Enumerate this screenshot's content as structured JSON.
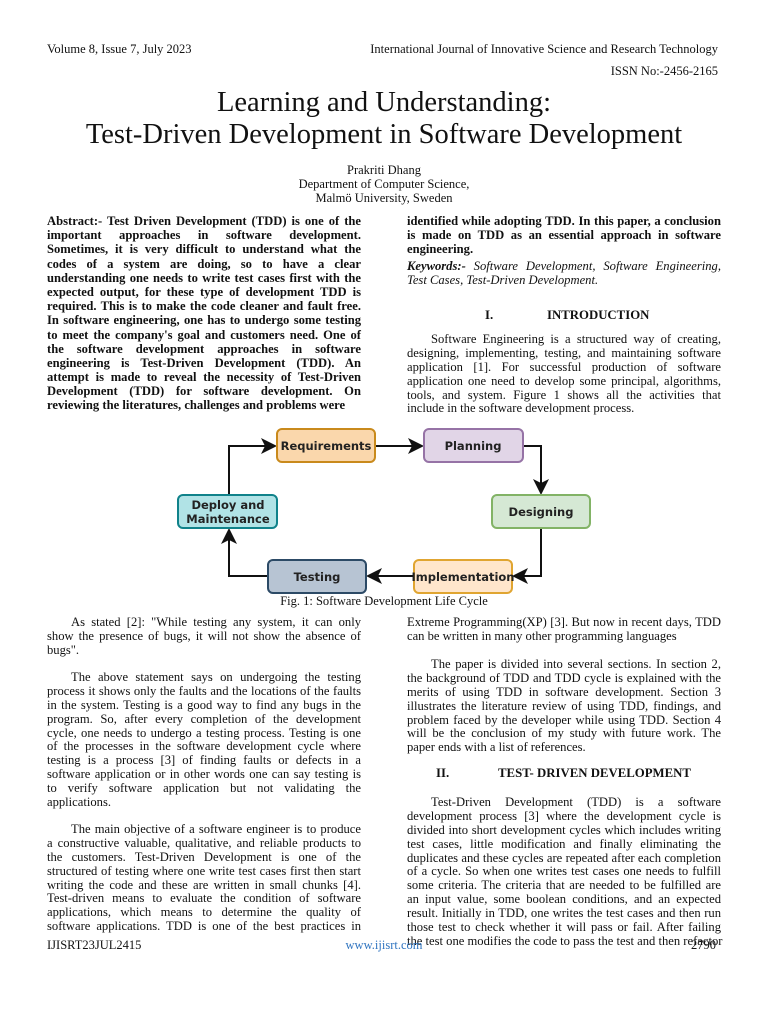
{
  "header": {
    "volume": "Volume 8, Issue 7, July 2023",
    "journal": "International Journal of Innovative Science and Research Technology",
    "issn": "ISSN No:-2456-2165"
  },
  "title": {
    "line1": "Learning and Understanding:",
    "line2": "Test-Driven Development in Software Development"
  },
  "author": {
    "name": "Prakriti Dhang",
    "dept": "Department of Computer Science,",
    "univ": "Malmö University, Sweden"
  },
  "abstract_left": [
    "Abstract:- Test Driven Development (TDD) is one of the",
    "important approaches in software development.",
    "Sometimes, it is very difficult to understand what the",
    "codes of a system are doing, so to have a clear",
    "understanding one needs to write test cases first with the",
    "expected output, for these type of development TDD is",
    "required. This is to make the code cleaner and fault free.",
    "In software engineering, one has to undergo some testing",
    "to meet the company's goal and customers need. One of",
    "the software development approaches in software",
    "engineering is Test-Driven Development (TDD). An",
    "attempt is made to reveal the necessity of Test-Driven",
    "Development (TDD) for software development. On",
    "reviewing the literatures, challenges and problems were"
  ],
  "abstract_right": [
    "identified while adopting TDD. In this paper, a conclusion",
    "is made on TDD as an essential approach in software",
    "engineering."
  ],
  "keywords": {
    "label": "Keywords:-",
    "line1": "Software Development, Software Engineering,",
    "line2": "Test Cases, Test-Driven Development."
  },
  "section1": {
    "num": "I.",
    "title": "INTRODUCTION"
  },
  "intro": [
    "Software Engineering is a structured way of creating,",
    "designing, implementing, testing, and maintaining software",
    "application [1]. For successful production of software",
    "application one need to develop some principal, algorithms,",
    "tools, and system. Figure 1 shows all the activities that",
    "include in the software development process."
  ],
  "figure": {
    "boxes": {
      "requirements": "Requirements",
      "planning": "Planning",
      "designing": "Designing",
      "implementation": "Implementation",
      "testing": "Testing",
      "deploy1": "Deploy and",
      "deploy2": "Maintenance"
    },
    "caption": "Fig. 1: Software Development Life Cycle",
    "colors": {
      "requirements": "#fad7ac",
      "planning": "#e1d5e7",
      "designing": "#d5e8d4",
      "implementation": "#ffe6cc",
      "testing": "#b7c4d3",
      "deploy": "#b1e3e6"
    }
  },
  "left_p1": [
    "As stated [2]: \"While testing any system, it can only",
    "show the presence of bugs, it will not show the absence of",
    "bugs\"."
  ],
  "left_p2": [
    "The above statement says on undergoing the testing",
    "process it shows only the faults and the locations of the faults",
    "in the system. Testing is a good way to find any bugs in the",
    "program. So, after every completion of the development",
    "cycle, one needs to undergo a testing process. Testing is one",
    "of the processes in the software development cycle where",
    "testing is a process [3] of finding faults or defects in a",
    "software application or in other words one can say testing is",
    "to verify software application but not validating the",
    "applications."
  ],
  "left_p3": [
    "The main objective of a software engineer is to produce",
    "a constructive valuable, qualitative, and reliable products to",
    "the customers. Test-Driven Development is one of the",
    "structured of testing where one write test cases first then start",
    "writing the code and these are written in small chunks [4].",
    "Test-driven means to evaluate the condition of software",
    "applications, which means to determine the quality of",
    "software applications. TDD is one of the best practices in"
  ],
  "right_p1": [
    "Extreme Programming(XP) [3]. But now in recent days, TDD",
    "can be written in many other programming languages"
  ],
  "right_p2": [
    "The paper is divided into several sections. In section 2,",
    "the background of TDD and TDD cycle is explained with the",
    "merits of using TDD in software development. Section 3",
    "illustrates the literature review of using TDD, findings, and",
    "problem faced by the developer while using TDD. Section 4",
    "will be the conclusion of my study with future work. The",
    "paper ends with a list of references."
  ],
  "section2": {
    "num": "II.",
    "title": "TEST- DRIVEN DEVELOPMENT"
  },
  "right_p3": [
    "Test-Driven Development (TDD) is a software",
    "development process [3] where the development cycle is",
    "divided into short development cycles which includes writing",
    "test cases, little modification and finally eliminating the",
    "duplicates and these cycles are repeated after each completion",
    "of a cycle. So when one writes test cases one needs to fulfill",
    "some criteria. The criteria that are needed to be fulfilled are",
    "an input value, some boolean conditions, and an expected",
    "result. Initially in TDD, one writes the test cases and then run",
    "those test to check whether it will pass or fail. After failing",
    "the test one modifies the code to pass the test and then refactor"
  ],
  "footer": {
    "code": "IJISRT23JUL2415",
    "url": "www.ijisrt.com",
    "page": "2790"
  }
}
